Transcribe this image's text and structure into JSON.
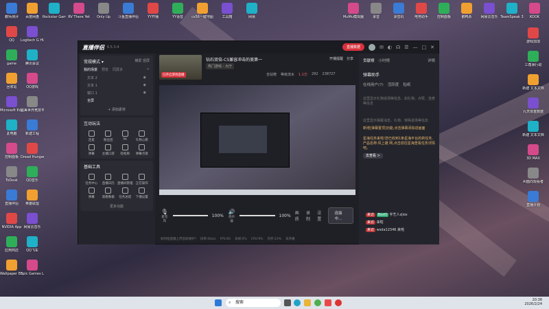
{
  "desktop": {
    "icons_left": [
      {
        "label": "教师测评"
      },
      {
        "label": "QQ"
      },
      {
        "label": "game"
      },
      {
        "label": "回收站"
      },
      {
        "label": "Microsoft Edge"
      },
      {
        "label": "此电脑"
      },
      {
        "label": "控制面板"
      },
      {
        "label": "ToDesk"
      },
      {
        "label": "直播伴侣"
      },
      {
        "label": "NVIDIA App"
      },
      {
        "label": "应用商店"
      },
      {
        "label": "Wallpaper Engine"
      }
    ],
    "icons_col2": [
      {
        "label": "百度网盘"
      },
      {
        "label": "Logitech G HUB"
      },
      {
        "label": "腾讯会议"
      },
      {
        "label": "QQ游戏"
      },
      {
        "label": "完美世界竞技平台"
      },
      {
        "label": "新建工程"
      },
      {
        "label": "Dread Hunger"
      },
      {
        "label": "QQ音乐"
      },
      {
        "label": "英雄联盟"
      },
      {
        "label": "网易云音乐"
      },
      {
        "label": "QQ飞车"
      },
      {
        "label": "Epic Games Launcher"
      }
    ],
    "icons_top": [
      {
        "label": "Rockstar Games"
      },
      {
        "label": "RV There Yet"
      },
      {
        "label": "Only Up"
      },
      {
        "label": "斗鱼直播伴侣"
      },
      {
        "label": "YY开播"
      },
      {
        "label": "YY语音"
      },
      {
        "label": "cs56一键地图"
      },
      {
        "label": "工具箱"
      },
      {
        "label": "网易"
      },
      {
        "label": "MuMu模拟器"
      },
      {
        "label": "录音"
      },
      {
        "label": "录音机"
      },
      {
        "label": "电竞助手"
      },
      {
        "label": "控制面板"
      },
      {
        "label": "鹅鸭杀"
      },
      {
        "label": "网易云音乐"
      },
      {
        "label": "TeamSpeak 3"
      },
      {
        "label": "KOOK"
      }
    ],
    "icons_right": [
      {
        "label": "游戏加加"
      },
      {
        "label": "三角洲行动"
      },
      {
        "label": "新建 文本文档"
      },
      {
        "label": "九天体重数据"
      },
      {
        "label": "新建 文本文档"
      },
      {
        "label": "3D MAX"
      },
      {
        "label": "AI面向观看者"
      },
      {
        "label": "直播计划"
      }
    ]
  },
  "app": {
    "title": "直播伴侣",
    "version": "6.5.3.4",
    "live_data_button": "直播数据",
    "mode_label": "常规模式",
    "mode_actions": [
      "横屏",
      "竖屏"
    ],
    "scene_section": "我的场景",
    "scene_tabs": [
      "我的场景",
      "预览",
      "同屏多"
    ],
    "scenes": [
      "文本 2",
      "文本 1",
      "窗口 1",
      "全屏"
    ],
    "add_source": "+ 添加素材",
    "interact_title": "互动玩法",
    "interact_tools": [
      "连麦",
      "粉丝团",
      "PK",
      "礼物心愿",
      "弹幕",
      "主播口袋",
      "轻松刷",
      "弹幕点歌"
    ],
    "basic_title": "基础工具",
    "basic_tools": [
      "任务中心",
      "直播日历",
      "直播间管理",
      "正在操作",
      "弹幕",
      "观看数据",
      "任务总结",
      "下播设置"
    ],
    "more_features": "更多功能",
    "stream_title": "钻石双倍-CS兼容冲击的美第一",
    "stream_category": "热门游戏 - 大厅",
    "stream_badge": "已开启游戏直播",
    "stream_stats": [
      "全站榜",
      "等级流水",
      "1.1万",
      "292",
      "238727"
    ],
    "start_button": "开播提醒",
    "share_button": "分享",
    "mic_label": "麦克风",
    "mic_level": "100%",
    "speaker_label": "扬声器",
    "speaker_level": "100%",
    "bottom_actions": [
      "画质",
      "录制",
      "设置"
    ],
    "connect_button": "连接中...",
    "status_items": [
      "如何给直播上传首屏保护?",
      "码率:0kb/s",
      "FPS:60",
      "丢帧:0%",
      "CPU:9%",
      "内存:23%",
      "未开播"
    ]
  },
  "right_panel": {
    "tabs": [
      "贡献榜",
      "小时榜",
      "详情"
    ],
    "assistant_title": "弹幕助手",
    "assistant_tabs": [
      "在线用户(7)",
      "活跃度",
      "贴纸"
    ],
    "messages": [
      "这里显示礼物进场等信息、如礼物、点赞、连麦等信息",
      "这里显示弹幕消息、礼物、特殊进场等信息",
      "新增[弹幕置顶]功能,点击弹幕添加进画面",
      "星海任务来啦!您已收到1条星海平台的新任务,产品名称:风上雄 网,点击前往星海查看任务详情吧。",
      "去查看 >"
    ],
    "users": [
      {
        "tag": "来访",
        "name": "BxxO",
        "text": "字艺人zjiox"
      },
      {
        "tag": "来访",
        "name": "来啦"
      },
      {
        "tag": "来访",
        "name": "wsda12346",
        "text": "来啦"
      }
    ]
  },
  "taskbar": {
    "search_placeholder": "搜索",
    "time": "20:38",
    "date": "2026/2/24"
  }
}
